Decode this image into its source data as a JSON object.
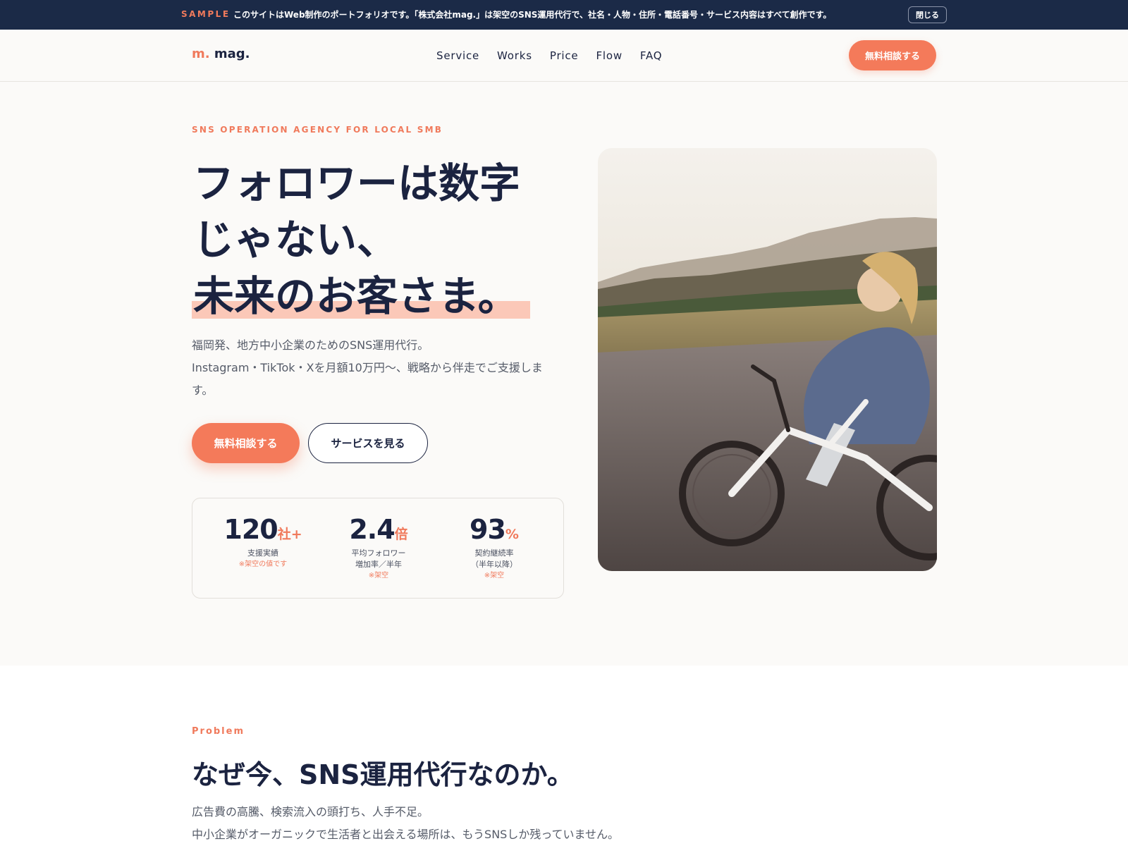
{
  "sample_bar": {
    "tag": "SAMPLE",
    "text": "このサイトはWeb制作のポートフォリオです。「株式会社mag.」は架空のSNS運用代行で、社名・人物・住所・電話番号・サービス内容はすべて創作です。",
    "close_label": "閉じる"
  },
  "header": {
    "logo_mark": "m.",
    "logo_text": "mag.",
    "nav": [
      "Service",
      "Works",
      "Price",
      "Flow",
      "FAQ"
    ],
    "cta_label": "無料相談する"
  },
  "hero": {
    "eyebrow": "SNS OPERATION AGENCY FOR LOCAL SMB",
    "title_lines": [
      "フォロワーは数字",
      "じゃない、",
      "未来のお客さま。"
    ],
    "sub_lines": [
      "福岡発、地方中小企業のためのSNS運用代行。",
      "Instagram・TikTok・Xを月額10万円〜、戦略から伴走でご支援しま",
      "す。"
    ],
    "primary_button": "無料相談する",
    "secondary_button": "サービスを見る",
    "stats": [
      {
        "value": "120",
        "unit": "社+",
        "label_lines": [
          "支援実績"
        ],
        "note": "※架空の値です"
      },
      {
        "value": "2.4",
        "unit": "倍",
        "label_lines": [
          "平均フォロワー",
          "増加率／半年"
        ],
        "note": "※架空"
      },
      {
        "value": "93",
        "unit": "%",
        "label_lines": [
          "契約継続率",
          "（半年以降）"
        ],
        "note": "※架空"
      }
    ]
  },
  "problem": {
    "eyebrow": "Problem",
    "title": "なぜ今、SNS運用代行なのか。",
    "body_lines": [
      "広告費の高騰、検索流入の頭打ち、人手不足。",
      "中小企業がオーガニックで生活者と出会える場所は、もうSNSしか残っていません。"
    ]
  },
  "colors": {
    "navy": "#1b2a47",
    "accent": "#f47a5a",
    "text": "#1b2340",
    "highlight": "#fbc8b8"
  }
}
